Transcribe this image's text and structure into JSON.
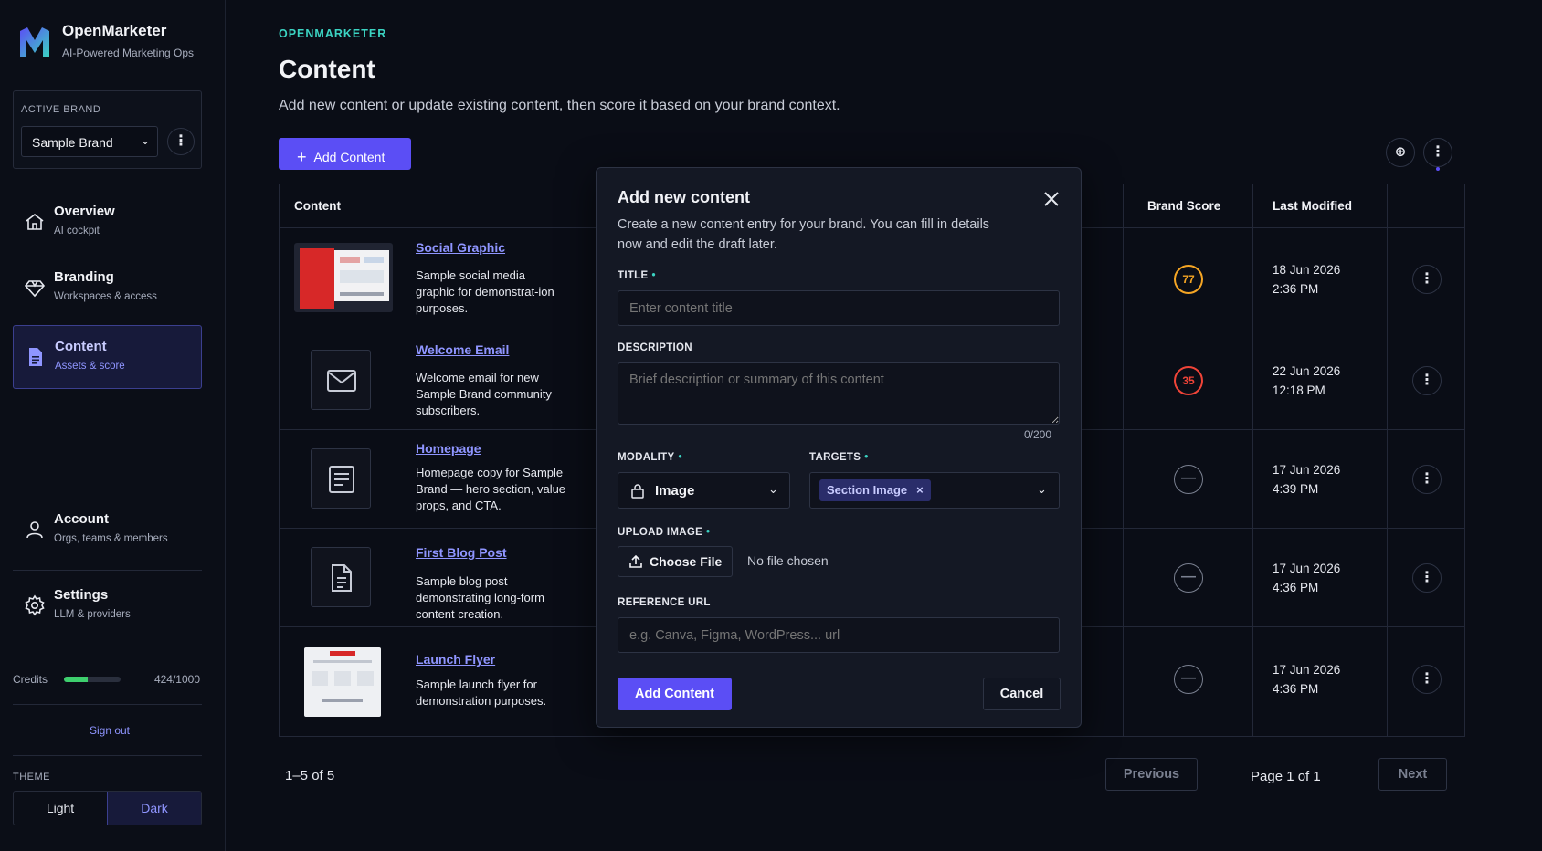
{
  "app": {
    "name": "OpenMarketer",
    "tagline": "AI-Powered Marketing Ops"
  },
  "active_brand": {
    "label": "ACTIVE BRAND",
    "value": "Sample Brand"
  },
  "nav": [
    {
      "title": "Overview",
      "sub": "AI cockpit",
      "icon": "home-icon"
    },
    {
      "title": "Branding",
      "sub": "Workspaces & access",
      "icon": "diamond-icon"
    },
    {
      "title": "Content",
      "sub": "Assets & score",
      "icon": "document-icon",
      "active": true
    },
    {
      "title": "Account",
      "sub": "Orgs, teams & members",
      "icon": "user-icon"
    },
    {
      "title": "Settings",
      "sub": "LLM & providers",
      "icon": "gear-icon"
    }
  ],
  "credits": {
    "label": "Credits",
    "value": "424/1000",
    "fraction": 0.424
  },
  "signout": "Sign out",
  "theme": {
    "label": "THEME",
    "light": "Light",
    "dark": "Dark",
    "selected": "Dark"
  },
  "header": {
    "eyebrow": "OPENMARKETER",
    "title": "Content",
    "subtitle": "Add new content or update existing content, then score it based on your brand context.",
    "add_button": "Add Content"
  },
  "table": {
    "columns": {
      "content": "Content",
      "brand_score": "Brand Score",
      "last_modified": "Last Modified"
    },
    "rows": [
      {
        "title": "Social Graphic",
        "desc": "Sample social media graphic for demonstrat-ion purposes.",
        "score": "77",
        "score_color": "#f5a524",
        "date": "18 Jun 2026",
        "time": "2:36 PM",
        "thumb": "image"
      },
      {
        "title": "Welcome Email",
        "desc": "Welcome email for new Sample Brand community subscribers.",
        "score": "35",
        "score_color": "#f04438",
        "date": "22 Jun 2026",
        "time": "12:18 PM",
        "thumb": "mail-icon"
      },
      {
        "title": "Homepage",
        "desc": "Homepage copy for Sample Brand — hero section, value props, and CTA.",
        "score": "—",
        "date": "17 Jun 2026",
        "time": "4:39 PM",
        "thumb": "page-icon"
      },
      {
        "title": "First Blog Post",
        "desc": "Sample blog post demonstrating long-form content creation.",
        "score": "—",
        "date": "17 Jun 2026",
        "time": "4:36 PM",
        "thumb": "file-icon"
      },
      {
        "title": "Launch Flyer",
        "desc": "Sample launch flyer for demonstration purposes.",
        "score": "—",
        "date": "17 Jun 2026",
        "time": "4:36 PM",
        "thumb": "image"
      }
    ]
  },
  "pagination": {
    "range": "1–5 of 5",
    "previous": "Previous",
    "page": "Page 1 of 1",
    "next": "Next"
  },
  "modal": {
    "title": "Add new content",
    "description": "Create a new content entry for your brand. You can fill in details now and edit the draft later.",
    "title_label": "TITLE",
    "title_placeholder": "Enter content title",
    "description_label": "DESCRIPTION",
    "description_placeholder": "Brief description or summary of this content",
    "counter": "0/200",
    "modality_label": "MODALITY",
    "modality_value": "Image",
    "targets_label": "TARGETS",
    "target_chip": "Section Image",
    "upload_label": "UPLOAD IMAGE",
    "choose_file": "Choose File",
    "no_file": "No file chosen",
    "reference_label": "REFERENCE URL",
    "reference_placeholder": "e.g. Canva, Figma, WordPress... url",
    "submit": "Add Content",
    "cancel": "Cancel"
  }
}
